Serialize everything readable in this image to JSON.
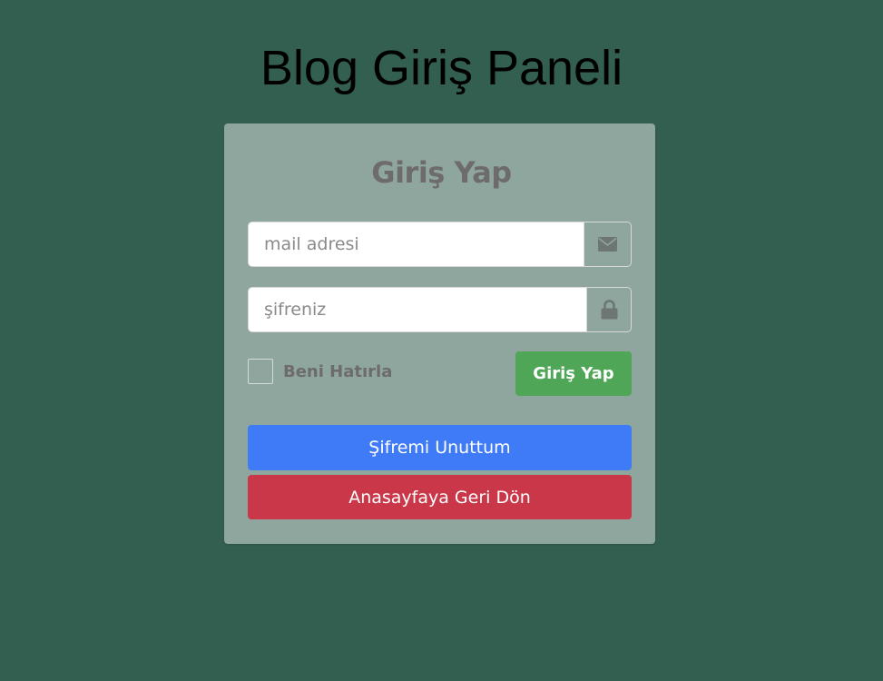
{
  "page": {
    "title": "Blog Giriş Paneli",
    "background_color": "#335f51"
  },
  "login_card": {
    "heading": "Giriş Yap",
    "email_field": {
      "placeholder": "mail adresi",
      "value": "",
      "icon": "envelope-icon"
    },
    "password_field": {
      "placeholder": "şifreniz",
      "value": "",
      "icon": "lock-icon"
    },
    "remember_me": {
      "label": "Beni Hatırla",
      "checked": false
    },
    "login_button_label": "Giriş Yap",
    "forgot_password_label": "Şifremi Unuttum",
    "back_home_label": "Anasayfaya Geri Dön"
  },
  "colors": {
    "card_bg": "#8fa69f",
    "login_button": "#4fa656",
    "forgot_button": "#3f7bf7",
    "home_button": "#c93748",
    "muted_text": "#6e6b6c"
  }
}
